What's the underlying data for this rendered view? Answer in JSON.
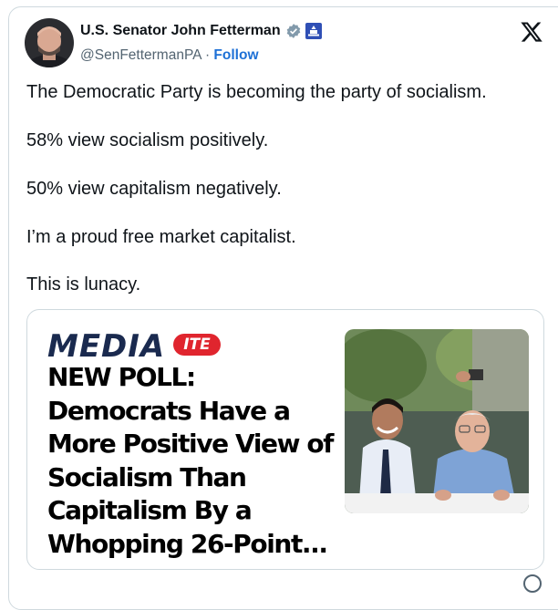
{
  "author": {
    "display_name": "U.S. Senator John Fetterman",
    "handle": "@SenFettermanPA",
    "separator": "·",
    "follow_label": "Follow",
    "verified_icon": "verified-check-icon",
    "affiliation_icon": "us-capitol-badge-icon"
  },
  "tweet": {
    "lines": [
      "The Democratic Party is becoming the party of socialism.",
      "58% view socialism positively.",
      "50% view capitalism negatively.",
      "I’m a proud free market capitalist.",
      "This is lunacy."
    ]
  },
  "link_card": {
    "logo_main": "MEDIA",
    "logo_badge": "ITE",
    "headline_lines": [
      "NEW POLL:",
      "Democrats Have a",
      "More Positive View of",
      "Socialism Than",
      "Capitalism By a",
      "Whopping 26-Point..."
    ]
  },
  "colors": {
    "link_blue": "#1d70d6",
    "verified_gray": "#829aab",
    "logo_navy": "#1a2a4f",
    "logo_red": "#e0252e"
  }
}
